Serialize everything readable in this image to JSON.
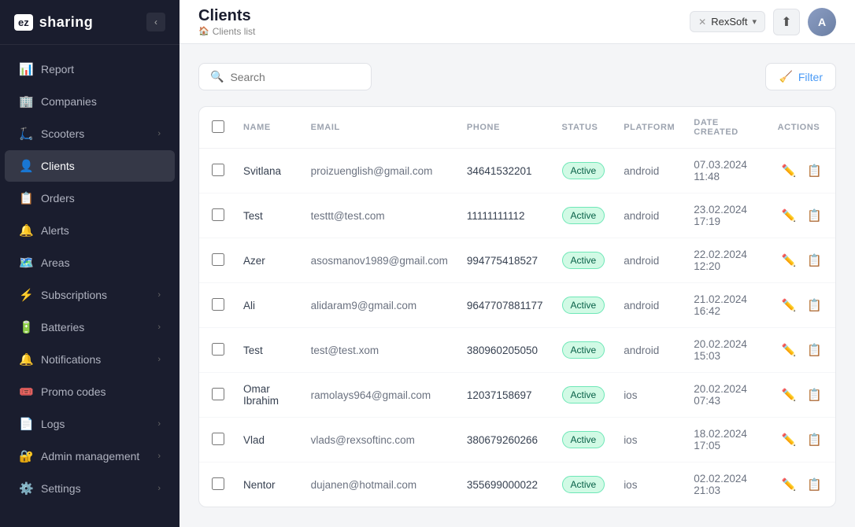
{
  "app": {
    "logo_prefix": "ez",
    "logo_suffix": "sharing"
  },
  "topbar": {
    "page_title": "Clients",
    "breadcrumb_label": "Clients list",
    "company_badge": "RexSoft",
    "notifications_icon": "🔔"
  },
  "sidebar": {
    "items": [
      {
        "id": "report",
        "label": "Report",
        "icon": "📊",
        "has_chevron": false,
        "active": false
      },
      {
        "id": "companies",
        "label": "Companies",
        "icon": "🏢",
        "has_chevron": false,
        "active": false
      },
      {
        "id": "scooters",
        "label": "Scooters",
        "icon": "🛴",
        "has_chevron": true,
        "active": false
      },
      {
        "id": "clients",
        "label": "Clients",
        "icon": "👤",
        "has_chevron": false,
        "active": true
      },
      {
        "id": "orders",
        "label": "Orders",
        "icon": "📋",
        "has_chevron": false,
        "active": false
      },
      {
        "id": "alerts",
        "label": "Alerts",
        "icon": "🔔",
        "has_chevron": false,
        "active": false
      },
      {
        "id": "areas",
        "label": "Areas",
        "icon": "🗺️",
        "has_chevron": false,
        "active": false
      },
      {
        "id": "subscriptions",
        "label": "Subscriptions",
        "icon": "⚡",
        "has_chevron": true,
        "active": false
      },
      {
        "id": "batteries",
        "label": "Batteries",
        "icon": "🔋",
        "has_chevron": true,
        "active": false
      },
      {
        "id": "notifications",
        "label": "Notifications",
        "icon": "🔔",
        "has_chevron": true,
        "active": false
      },
      {
        "id": "promo-codes",
        "label": "Promo codes",
        "icon": "🎟️",
        "has_chevron": false,
        "active": false
      },
      {
        "id": "logs",
        "label": "Logs",
        "icon": "📄",
        "has_chevron": true,
        "active": false
      },
      {
        "id": "admin-management",
        "label": "Admin management",
        "icon": "🔐",
        "has_chevron": true,
        "active": false
      },
      {
        "id": "settings",
        "label": "Settings",
        "icon": "⚙️",
        "has_chevron": true,
        "active": false
      }
    ]
  },
  "toolbar": {
    "search_placeholder": "Search",
    "filter_label": "Filter"
  },
  "table": {
    "columns": [
      {
        "id": "checkbox",
        "label": ""
      },
      {
        "id": "name",
        "label": "NAME"
      },
      {
        "id": "email",
        "label": "EMAIL"
      },
      {
        "id": "phone",
        "label": "PHONE"
      },
      {
        "id": "status",
        "label": "STATUS"
      },
      {
        "id": "platform",
        "label": "PLATFORM"
      },
      {
        "id": "date_created",
        "label": "DATE CREATED"
      },
      {
        "id": "actions",
        "label": "ACTIONS"
      }
    ],
    "rows": [
      {
        "name": "Svitlana",
        "email": "proizuenglish@gmail.com",
        "phone": "34641532201",
        "status": "Active",
        "platform": "android",
        "date_created": "07.03.2024 11:48"
      },
      {
        "name": "Test",
        "email": "testtt@test.com",
        "phone": "11111111112",
        "status": "Active",
        "platform": "android",
        "date_created": "23.02.2024 17:19"
      },
      {
        "name": "Azer",
        "email": "asosmanov1989@gmail.com",
        "phone": "994775418527",
        "status": "Active",
        "platform": "android",
        "date_created": "22.02.2024 12:20"
      },
      {
        "name": "Ali",
        "email": "alidaram9@gmail.com",
        "phone": "9647707881177",
        "status": "Active",
        "platform": "android",
        "date_created": "21.02.2024 16:42"
      },
      {
        "name": "Test",
        "email": "test@test.xom",
        "phone": "380960205050",
        "status": "Active",
        "platform": "android",
        "date_created": "20.02.2024 15:03"
      },
      {
        "name": "Omar Ibrahim",
        "email": "ramolays964@gmail.com",
        "phone": "12037158697",
        "status": "Active",
        "platform": "ios",
        "date_created": "20.02.2024 07:43"
      },
      {
        "name": "Vlad",
        "email": "vlads@rexsoftinc.com",
        "phone": "380679260266",
        "status": "Active",
        "platform": "ios",
        "date_created": "18.02.2024 17:05"
      },
      {
        "name": "Nentor",
        "email": "dujanen@hotmail.com",
        "phone": "355699000022",
        "status": "Active",
        "platform": "ios",
        "date_created": "02.02.2024 21:03"
      }
    ]
  }
}
